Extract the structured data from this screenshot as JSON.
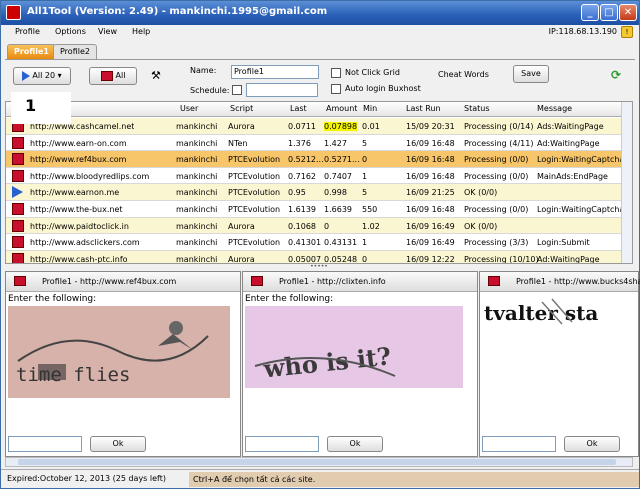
{
  "window": {
    "title": "All1Tool (Version: 2.49) - mankinchi.1995@gmail.com",
    "min": "_",
    "max": "□",
    "close": "✕"
  },
  "menu": [
    "Profile",
    "Options",
    "View",
    "Help"
  ],
  "ip": "IP:118.68.13.190",
  "tabs": [
    "Profile1",
    "Profile2"
  ],
  "toolbar": {
    "all20": "All 20",
    "all20_arrow": "▾",
    "all": "All",
    "name_label": "Name:",
    "name_value": "Profile1",
    "schedule_label": "Schedule:",
    "not_click_grid": "Not Click Grid",
    "auto_login": "Auto login Buxhost",
    "cheat_words": "Cheat Words",
    "save": "Save"
  },
  "overlay_number": "1",
  "grid": {
    "columns": [
      "",
      "User",
      "Script",
      "Last",
      "Amount",
      "Min",
      "Last Run",
      "Status",
      "Message"
    ],
    "rows": [
      {
        "icon": "stop",
        "site": "http://www.cashcamel.net",
        "user": "mankinchi",
        "script": "Aurora",
        "last": "0.0711",
        "amount": "0.07898",
        "min": "0.01",
        "lastrun": "15/09 20:31",
        "status": "Processing (0/14)",
        "message": "Ads:WaitingPage",
        "hl_amount": true
      },
      {
        "icon": "stop",
        "site": "http://www.earn-on.com",
        "user": "mankinchi",
        "script": "NTen",
        "last": "1.376",
        "amount": "1.427",
        "min": "5",
        "lastrun": "16/09 16:48",
        "status": "Processing (4/11)",
        "message": "Ad:WaitingPage"
      },
      {
        "icon": "stop",
        "site": "http://www.ref4bux.com",
        "user": "mankinchi",
        "script": "PTCEvolution",
        "last": "0.5212...",
        "amount": "0.5271...",
        "min": "0",
        "lastrun": "16/09 16:48",
        "status": "Processing (0/0)",
        "message": "Login:WaitingCaptcha",
        "selected": true
      },
      {
        "icon": "stop",
        "site": "http://www.bloodyredlips.com",
        "user": "mankinchi",
        "script": "PTCEvolution",
        "last": "0.7162",
        "amount": "0.7407",
        "min": "1",
        "lastrun": "16/09 16:48",
        "status": "Processing (0/0)",
        "message": "MainAds:EndPage"
      },
      {
        "icon": "run",
        "site": "http://www.earnon.me",
        "user": "mankinchi",
        "script": "PTCEvolution",
        "last": "0.95",
        "amount": "0.998",
        "min": "5",
        "lastrun": "16/09 21:25",
        "status": "OK (0/0)",
        "message": ""
      },
      {
        "icon": "stop",
        "site": "http://www.the-bux.net",
        "user": "mankinchi",
        "script": "PTCEvolution",
        "last": "1.6139",
        "amount": "1.6639",
        "min": "550",
        "lastrun": "16/09 16:48",
        "status": "Processing (0/0)",
        "message": "Login:WaitingCaptcha"
      },
      {
        "icon": "stop",
        "site": "http://www.paidtoclick.in",
        "user": "mankinchi",
        "script": "Aurora",
        "last": "0.1068",
        "amount": "0",
        "min": "1.02",
        "lastrun": "16/09 16:49",
        "status": "OK (0/0)",
        "message": ""
      },
      {
        "icon": "stop",
        "site": "http://www.adsclickers.com",
        "user": "mankinchi",
        "script": "PTCEvolution",
        "last": "0.41301",
        "amount": "0.43131",
        "min": "1",
        "lastrun": "16/09 16:49",
        "status": "Processing (3/3)",
        "message": "Login:Submit"
      },
      {
        "icon": "stop",
        "site": "http://www.cash-ptc.info",
        "user": "mankinchi",
        "script": "Aurora",
        "last": "0.05007",
        "amount": "0.05248",
        "min": "0",
        "lastrun": "16/09 12:22",
        "status": "Processing (10/10)",
        "message": "Ad:WaitingPage"
      }
    ]
  },
  "splitter": "•••••",
  "panels": [
    {
      "title": "Profile1 - http://www.ref4bux.com",
      "prompt": "Enter the following:",
      "captcha": "time flies",
      "ok": "Ok"
    },
    {
      "title": "Profile1 - http://clixten.info",
      "prompt": "Enter the following:",
      "captcha": "who is it?",
      "ok": "Ok"
    },
    {
      "title": "Profile1 - http://www.bucks4share",
      "prompt": "",
      "captcha": "tvalter sta",
      "ok": "Ok"
    }
  ],
  "status": {
    "left": "Expired:October 12, 2013 (25 days left)",
    "right": "Ctrl+A để chọn tất cả các site."
  },
  "colors": {
    "title_bar": "#2a5fb8",
    "selected_row": "#f7c66a",
    "alt_row": "#fbf6d2",
    "stop": "#c8102e",
    "play": "#2a5fd0"
  }
}
